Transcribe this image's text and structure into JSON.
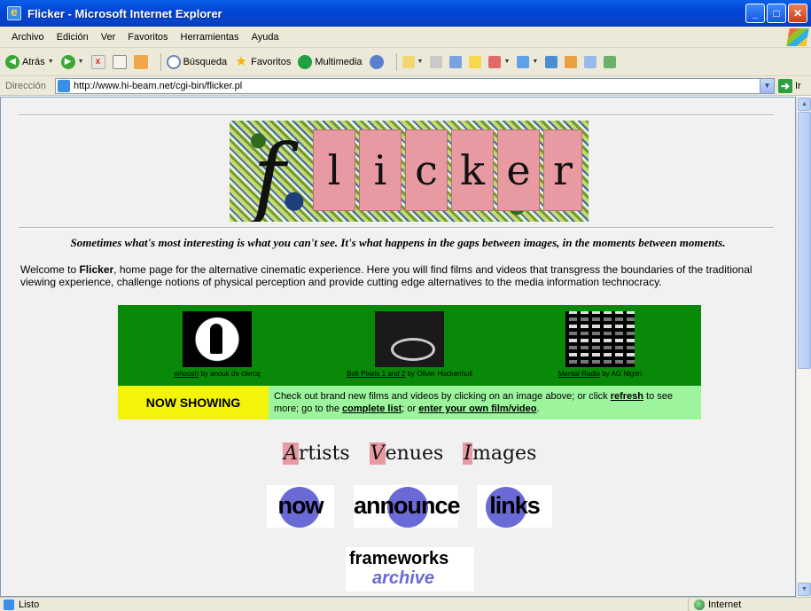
{
  "window": {
    "title": "Flicker - Microsoft Internet Explorer",
    "buttons": [
      "_",
      "□",
      "✕"
    ]
  },
  "menu": [
    "Archivo",
    "Edición",
    "Ver",
    "Favoritos",
    "Herramientas",
    "Ayuda"
  ],
  "toolbar": {
    "back_label": "Atrás",
    "search_label": "Búsqueda",
    "favorites_label": "Favoritos",
    "media_label": "Multimedia"
  },
  "address": {
    "label": "Dirección",
    "url": "http://www.hi-beam.net/cgi-bin/flicker.pl",
    "go_label": "Ir"
  },
  "page": {
    "banner_letters": [
      "l",
      "i",
      "c",
      "k",
      "e",
      "r"
    ],
    "banner_f": "f",
    "tagline": "Sometimes what's most interesting is what you can't see. It's what happens in the gaps between images, in the moments between moments.",
    "welcome_pre": "Welcome to ",
    "welcome_bold": "Flicker",
    "welcome_post": ", home page for the alternative cinematic experience. Here you will find films and videos that transgress the boundaries of the traditional viewing experience, challenge notions of physical perception and provide cutting edge alternatives to the media information technocracy.",
    "films": [
      {
        "title": "whoosh",
        "by": " by anouk de clercq"
      },
      {
        "title": "Bolt Pixels 1 and 2",
        "by": " by Oliver Hockenhull"
      },
      {
        "title": "Mental Radio",
        "by": " by AG Nigrin"
      }
    ],
    "now_showing": "NOW SHOWING",
    "now_text_1": "Check out brand new films and videos by clicking on an image above; or click ",
    "now_link_refresh": "refresh",
    "now_text_2": " to see more; go to the ",
    "now_link_list": "complete list",
    "now_text_3": "; or ",
    "now_link_enter": "enter your own film/video",
    "now_text_4": ".",
    "sections": [
      {
        "initial": "A",
        "rest": "rtists"
      },
      {
        "initial": "V",
        "rest": "enues"
      },
      {
        "initial": "I",
        "rest": "mages"
      }
    ],
    "nav_buttons": [
      "now",
      "announce",
      "links"
    ],
    "archive_line1": "frameworks",
    "archive_line2": "archive"
  },
  "status": {
    "text": "Listo",
    "zone": "Internet"
  },
  "colors": {
    "films_bg": "#088a08",
    "now_showing_bg": "#f4f40a",
    "now_text_bg": "#9cf59c",
    "tile_pink": "#e89aa2",
    "circle_purple": "#6a6ad6"
  }
}
